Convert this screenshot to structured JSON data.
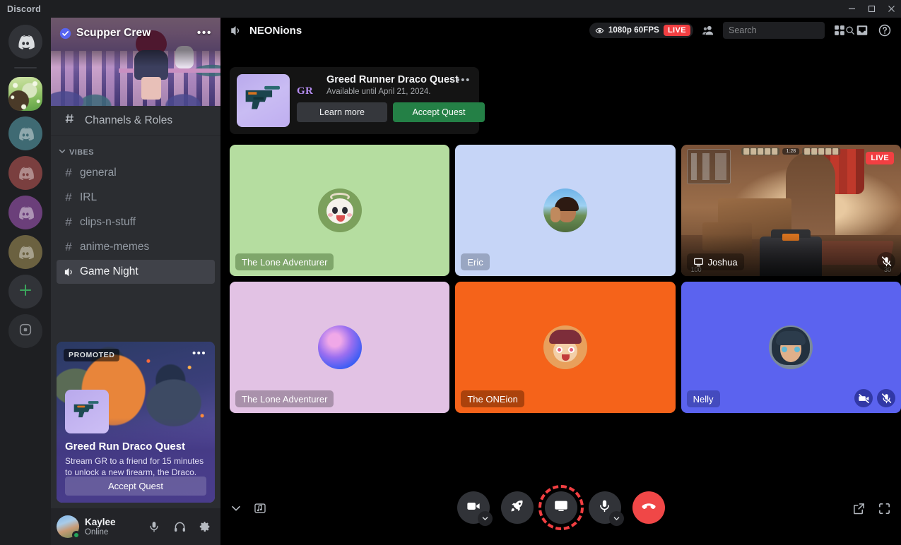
{
  "titlebar": {
    "app_name": "Discord",
    "minimize_icon": "minimize-icon",
    "maximize_icon": "maximize-icon",
    "close_icon": "close-icon"
  },
  "server_rail": {
    "items": [
      {
        "name": "home",
        "label": "Discord Home",
        "icon": "discord-logo-icon",
        "style": "home",
        "active": false
      },
      {
        "name": "scupper-crew",
        "label": "Scupper Crew",
        "icon": "server-avatar",
        "style": "nature",
        "active": true
      },
      {
        "name": "server-2",
        "label": "Server",
        "icon": "discord-logo-icon",
        "style": "teal",
        "active": false
      },
      {
        "name": "server-3",
        "label": "Server",
        "icon": "discord-logo-icon",
        "style": "red",
        "active": false
      },
      {
        "name": "server-4",
        "label": "Server",
        "icon": "discord-logo-icon",
        "style": "purple",
        "active": false
      },
      {
        "name": "server-5",
        "label": "Server",
        "icon": "discord-logo-icon",
        "style": "olive",
        "active": false
      }
    ],
    "add_server": {
      "label": "+",
      "icon": "plus-icon"
    },
    "explore": {
      "icon": "compass-icon"
    }
  },
  "sidebar": {
    "server_name": "Scupper Crew",
    "verified_icon": "verified-badge-icon",
    "more_icon": "more-options-icon",
    "more_glyph": "•••",
    "channels_and_roles": {
      "label": "Channels & Roles",
      "icon": "hash-search-icon"
    },
    "category": {
      "label": "VIBES",
      "chevron": "chevron-down-icon"
    },
    "channels": [
      {
        "name": "general",
        "label": "general",
        "type": "text",
        "selected": false
      },
      {
        "name": "irl",
        "label": "IRL",
        "type": "text",
        "selected": false
      },
      {
        "name": "clips-n-stuff",
        "label": "clips-n-stuff",
        "type": "text",
        "selected": false
      },
      {
        "name": "anime-memes",
        "label": "anime-memes",
        "type": "text",
        "selected": false
      },
      {
        "name": "game-night",
        "label": "Game Night",
        "type": "voice",
        "selected": true
      }
    ],
    "promoted": {
      "badge": "PROMOTED",
      "more_glyph": "•••",
      "title": "Greed Run Draco Quest",
      "description": "Stream GR to a friend for 15 minutes to unlock a new firearm, the Draco.",
      "cta": "Accept Quest"
    },
    "user": {
      "name": "Kaylee",
      "status": "Online",
      "status_color": "#23a55a",
      "mic_icon": "microphone-icon",
      "headset_icon": "headset-icon",
      "settings_icon": "gear-icon"
    }
  },
  "call": {
    "channel_icon": "speaker-icon",
    "channel_name": "NEONions",
    "stream_quality": "1080p 60FPS",
    "live_label": "LIVE",
    "stream_eye_icon": "eye-icon",
    "members_icon": "members-icon",
    "search": {
      "placeholder": "Search",
      "value": "",
      "icon": "search-icon"
    },
    "grid_view_icon": "grid-view-icon",
    "inbox_icon": "inbox-icon",
    "help_icon": "help-icon"
  },
  "quest": {
    "brand_initials": "GR",
    "title": "Greed Runner Draco Quest",
    "subtitle": "Available until April 21, 2024.",
    "more_glyph": "•••",
    "learn_more": "Learn more",
    "accept": "Accept Quest",
    "accent_green": "#248046",
    "art_icon": "firearm-icon"
  },
  "tiles": [
    {
      "name": "the-lone-adventurer-1",
      "label": "The Lone Adventurer",
      "bg": "#b5dda0",
      "name_bg": "rgba(112,150,92,0.78)",
      "avatar": "av-paimon",
      "live": false,
      "badges": []
    },
    {
      "name": "eric",
      "label": "Eric",
      "bg": "#c6d5f7",
      "name_bg": "rgba(140,152,180,0.78)",
      "avatar": "av-eric",
      "live": false,
      "badges": []
    },
    {
      "name": "joshua",
      "label": "Joshua",
      "bg": "#8a6042",
      "name_bg": "rgba(0,0,0,0.35)",
      "avatar": "game",
      "live": true,
      "live_label": "LIVE",
      "screen_icon": "monitor-icon",
      "badges": [
        "mic-muted-icon"
      ],
      "hud": {
        "health": "100",
        "ammo": "30",
        "timer": "1:28"
      }
    },
    {
      "name": "the-lone-adventurer-2",
      "label": "The Lone Adventurer",
      "bg": "#e2c2e4",
      "name_bg": "rgba(150,128,152,0.75)",
      "avatar": "av-orb",
      "live": false,
      "badges": []
    },
    {
      "name": "the-oneion",
      "label": "The ONEion",
      "bg": "#f5631a",
      "name_bg": "rgba(160,62,10,0.82)",
      "avatar": "av-hanako",
      "live": false,
      "badges": []
    },
    {
      "name": "nelly",
      "label": "Nelly",
      "bg": "#5b63ef",
      "name_bg": "rgba(60,66,170,0.75)",
      "avatar": "av-nelly",
      "live": false,
      "badges": [
        "video-off-icon",
        "mic-muted-icon"
      ]
    }
  ],
  "controls": {
    "expand_icon": "chevron-down-icon",
    "soundboard_icon": "soundboard-icon",
    "video_icon": "camera-icon",
    "video_chevron": "chevron-down-icon",
    "activities_icon": "rocket-icon",
    "screenshare_icon": "screen-share-icon",
    "screenshare_active": true,
    "screenshare_ring_color": "#f23f42",
    "mic_icon": "microphone-icon",
    "mic_chevron": "chevron-down-icon",
    "hangup_icon": "phone-hangup-icon",
    "hangup_color": "#f04747",
    "popout_icon": "popout-icon",
    "fullscreen_icon": "fullscreen-icon"
  }
}
